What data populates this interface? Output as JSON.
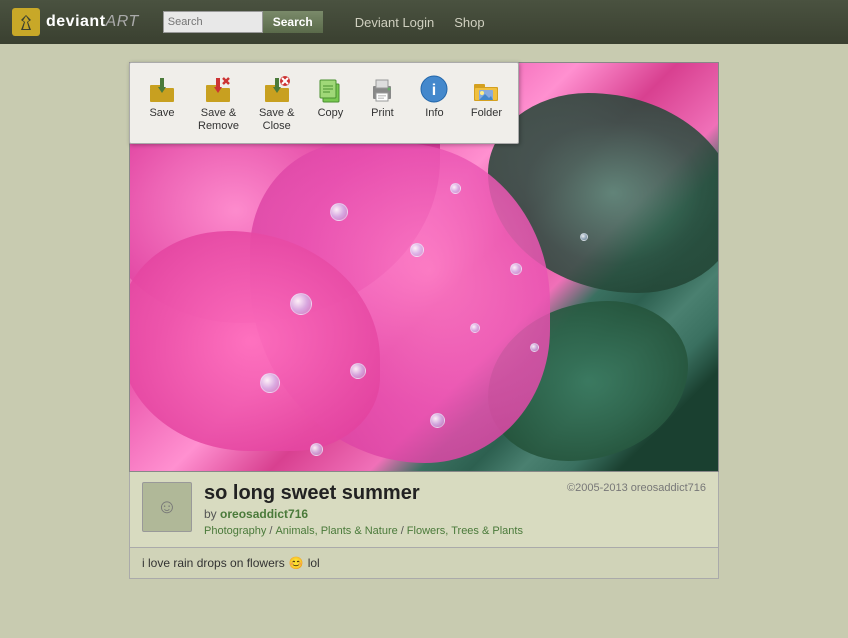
{
  "header": {
    "logo_text_bold": "deviant",
    "logo_text_normal": "ART",
    "search_placeholder": "Search",
    "search_button_label": "Search",
    "nav_items": [
      {
        "label": "Deviant Login",
        "href": "#"
      },
      {
        "label": "Shop",
        "href": "#"
      }
    ]
  },
  "toolbar": {
    "items": [
      {
        "id": "save",
        "label": "Save",
        "icon": "save-icon"
      },
      {
        "id": "save-remove",
        "label": "Save &\nRemove",
        "label_line1": "Save &",
        "label_line2": "Remove",
        "icon": "save-remove-icon"
      },
      {
        "id": "save-close",
        "label": "Save &\nClose",
        "label_line1": "Save &",
        "label_line2": "Close",
        "icon": "save-close-icon"
      },
      {
        "id": "copy",
        "label": "Copy",
        "icon": "copy-icon"
      },
      {
        "id": "print",
        "label": "Print",
        "icon": "print-icon"
      },
      {
        "id": "info",
        "label": "Info",
        "icon": "info-icon"
      },
      {
        "id": "folder",
        "label": "Folder",
        "icon": "folder-icon"
      }
    ]
  },
  "artwork": {
    "title": "so long sweet summer",
    "by_label": "by",
    "author": "oreosaddict716",
    "breadcrumb_parts": [
      "Photography",
      "/",
      "Animals, Plants & Nature",
      "/",
      "Flowers, Trees & Plants"
    ],
    "copyright": "©2005-2013 oreosaddict716",
    "comment": "i love rain drops on flowers",
    "comment_emoji": "😊",
    "comment_suffix": "lol"
  },
  "colors": {
    "accent_green": "#4a7a3a",
    "header_bg": "#3a4030",
    "toolbar_bg": "#f0eeea"
  }
}
